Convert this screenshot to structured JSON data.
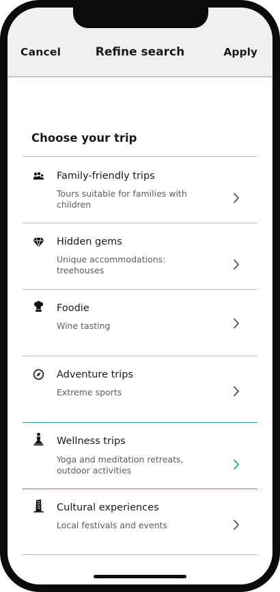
{
  "nav": {
    "cancel": "Cancel",
    "title": "Refine search",
    "apply": "Apply"
  },
  "section_title": "Choose your trip",
  "colors": {
    "accent": "#2aa79a",
    "text": "#1a1a1a",
    "muted": "#5c5c5c",
    "divider": "#b9b9b9",
    "nav_bg": "#f0f0f0"
  },
  "trips": [
    {
      "icon": "family-icon",
      "title": "Family-friendly trips",
      "desc": "Tours suitable for families with children",
      "highlighted": false
    },
    {
      "icon": "gem-icon",
      "title": "Hidden gems",
      "desc": "Unique accommodations: treehouses",
      "highlighted": false
    },
    {
      "icon": "chef-hat-icon",
      "title": "Foodie",
      "desc": "Wine tasting",
      "highlighted": false
    },
    {
      "icon": "compass-icon",
      "title": "Adventure trips",
      "desc": "Extreme sports",
      "highlighted": false
    },
    {
      "icon": "yoga-icon",
      "title": "Wellness trips",
      "desc": "Yoga and meditation retreats, outdoor activities",
      "highlighted": true
    },
    {
      "icon": "landmark-tower-icon",
      "title": "Cultural experiences",
      "desc": "Local festivals and events",
      "highlighted": false
    }
  ]
}
